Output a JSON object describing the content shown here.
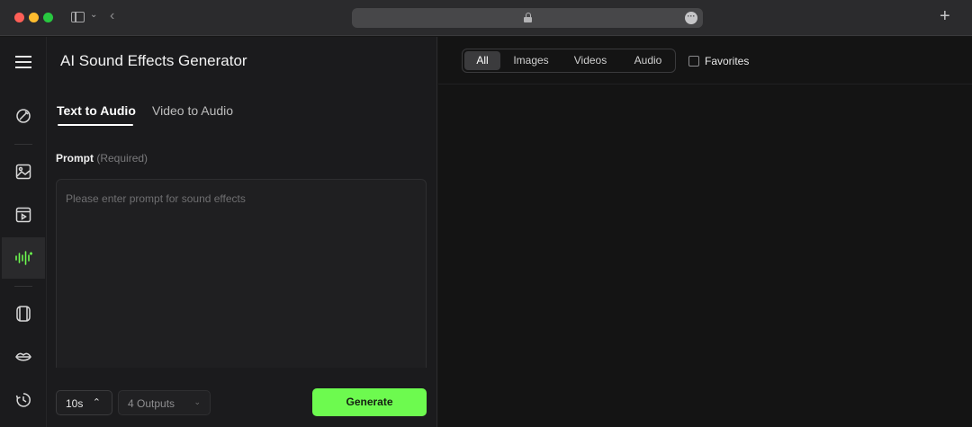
{
  "browser": {
    "icons": [
      "sidebar-toggle-icon",
      "chevron-down-icon",
      "back-arrow-icon",
      "lock-icon",
      "more-icon",
      "new-tab-icon"
    ]
  },
  "rail": {
    "items": [
      {
        "name": "rail-item-edit",
        "icon": "edit-icon"
      },
      {
        "name": "rail-item-image",
        "icon": "image-icon"
      },
      {
        "name": "rail-item-video",
        "icon": "video-icon"
      },
      {
        "name": "rail-item-audio",
        "icon": "sound-wave-icon",
        "active": true
      },
      {
        "name": "rail-item-avatar",
        "icon": "avatar-icon"
      },
      {
        "name": "rail-item-lipsync",
        "icon": "lips-icon"
      },
      {
        "name": "rail-item-history",
        "icon": "history-icon"
      }
    ],
    "accent": "#6dfa4f"
  },
  "panel": {
    "title": "AI Sound Effects Generator",
    "tabs": [
      "Text to Audio",
      "Video to Audio"
    ],
    "active_tab": "Text to Audio",
    "prompt_label": "Prompt",
    "prompt_required": "(Required)",
    "prompt_placeholder": "Please enter prompt for sound effects",
    "duration": "10s",
    "outputs": "4 Outputs",
    "generate_label": "Generate",
    "generate_color": "#6dfa4f"
  },
  "results": {
    "filters": [
      "All",
      "Images",
      "Videos",
      "Audio"
    ],
    "active_filter": "All",
    "favorites_label": "Favorites",
    "favorites_checked": false
  }
}
